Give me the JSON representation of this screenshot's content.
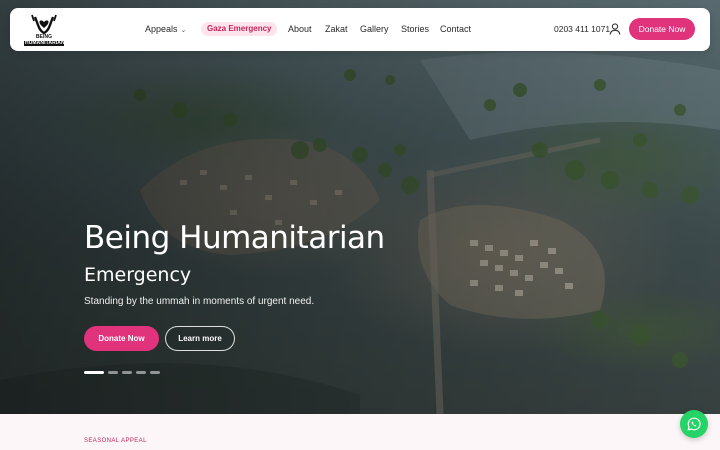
{
  "brand": {
    "logo_line1": "BEING",
    "logo_line2": "HUMANITARIAN"
  },
  "nav": {
    "items": [
      {
        "label": "Appeals",
        "has_dropdown": true
      },
      {
        "label": "Gaza Emergency",
        "highlight": true
      },
      {
        "label": "About"
      },
      {
        "label": "Zakat"
      },
      {
        "label": "Gallery"
      },
      {
        "label": "Stories"
      },
      {
        "label": "Contact"
      }
    ],
    "phone": "0203 411 1071",
    "user_icon": "user-icon",
    "donate_label": "Donate Now"
  },
  "hero": {
    "title": "Being Humanitarian",
    "subtitle": "Emergency",
    "description": "Standing by the ummah in moments of urgent need.",
    "primary_button": "Donate Now",
    "secondary_button": "Learn more",
    "slides_total": 5,
    "active_slide": 1
  },
  "section": {
    "eyebrow": "SEASONAL APPEAL"
  },
  "floating": {
    "whatsapp_icon": "whatsapp-icon"
  },
  "colors": {
    "accent": "#e0337b",
    "gaza_bg": "#fde4ec",
    "gaza_text": "#c2255c",
    "whatsapp": "#25d366"
  }
}
